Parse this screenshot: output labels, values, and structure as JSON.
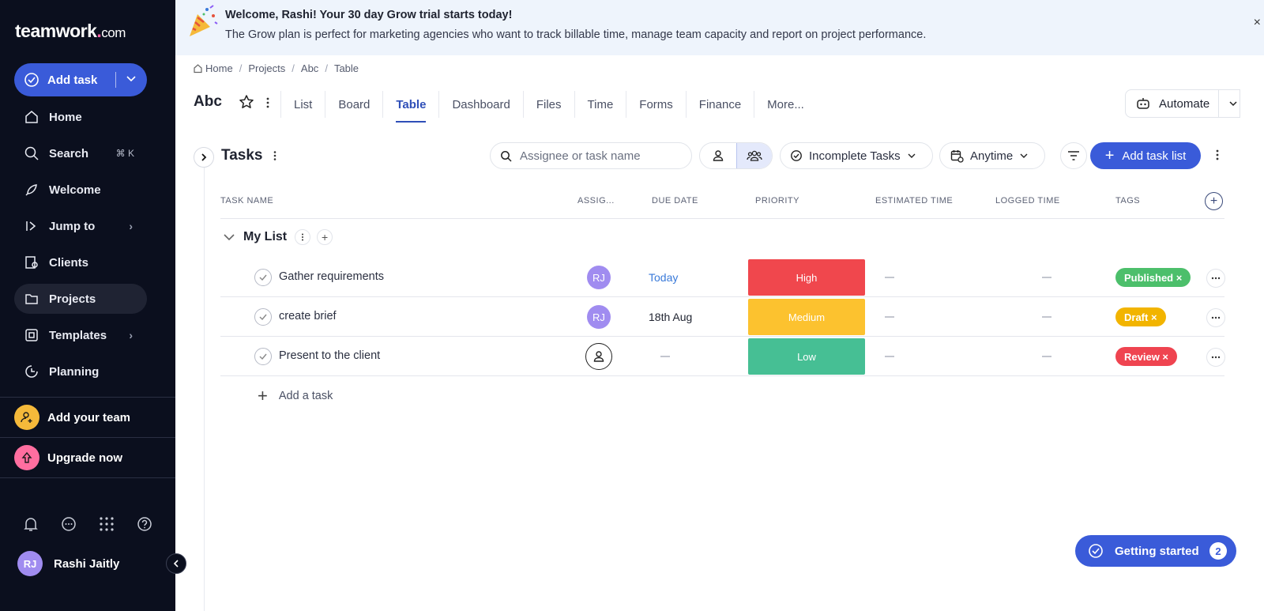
{
  "sidebar": {
    "logo": {
      "main": "teamwork",
      "dot": ".",
      "suffix": "com"
    },
    "add_task_label": "Add task",
    "nav": [
      {
        "label": "Home",
        "icon": "home-icon"
      },
      {
        "label": "Search",
        "icon": "search-icon",
        "shortcut": "⌘ K"
      },
      {
        "label": "Welcome",
        "icon": "rocket-icon"
      },
      {
        "label": "Jump to",
        "icon": "jump-icon",
        "chevron": "›"
      },
      {
        "label": "Clients",
        "icon": "clients-icon"
      },
      {
        "label": "Projects",
        "icon": "folder-icon"
      },
      {
        "label": "Templates",
        "icon": "templates-icon",
        "chevron": "›"
      },
      {
        "label": "Planning",
        "icon": "planning-icon"
      }
    ],
    "add_team_label": "Add your team",
    "upgrade_label": "Upgrade now",
    "user": {
      "initials": "RJ",
      "name": "Rashi Jaitly"
    }
  },
  "banner": {
    "title": "Welcome, Rashi! Your 30 day Grow trial starts today!",
    "subtitle": "The Grow plan is perfect for marketing agencies who want to track billable time, manage team capacity and report on project performance.",
    "close": "×"
  },
  "breadcrumb": [
    "Home",
    "Projects",
    "Abc",
    "Table"
  ],
  "project": {
    "title": "Abc",
    "tabs": [
      "List",
      "Board",
      "Table",
      "Dashboard",
      "Files",
      "Time",
      "Forms",
      "Finance",
      "More..."
    ],
    "active_tab": "Table",
    "automate_label": "Automate"
  },
  "toolbar": {
    "title": "Tasks",
    "search_placeholder": "Assignee or task name",
    "status_filter": "Incomplete Tasks",
    "date_filter": "Anytime",
    "add_list_label": "Add task list"
  },
  "table": {
    "columns": [
      "TASK NAME",
      "ASSIG...",
      "DUE DATE",
      "PRIORITY",
      "ESTIMATED TIME",
      "LOGGED TIME",
      "TAGS"
    ],
    "list_name": "My List",
    "rows": [
      {
        "name": "Gather requirements",
        "assignee": "RJ",
        "due": "Today",
        "priority": "High",
        "priority_color": "#f0474d",
        "tag": "Published ×",
        "tag_color": "#4cbf6b"
      },
      {
        "name": "create brief",
        "assignee": "RJ",
        "due": "18th Aug",
        "priority": "Medium",
        "priority_color": "#fcc22f",
        "tag": "Draft ×",
        "tag_color": "#f2b400"
      },
      {
        "name": "Present to the client",
        "assignee": "",
        "due": "",
        "priority": "Low",
        "priority_color": "#46bf94",
        "tag": "Review ×",
        "tag_color": "#ef4450"
      }
    ],
    "add_task_label": "Add a task"
  },
  "getting_started": {
    "label": "Getting started",
    "count": "2"
  },
  "colors": {
    "accent": "#3a5bd9",
    "sidebar_bg": "#0b0f1e",
    "banner_bg": "#eef4fc"
  }
}
